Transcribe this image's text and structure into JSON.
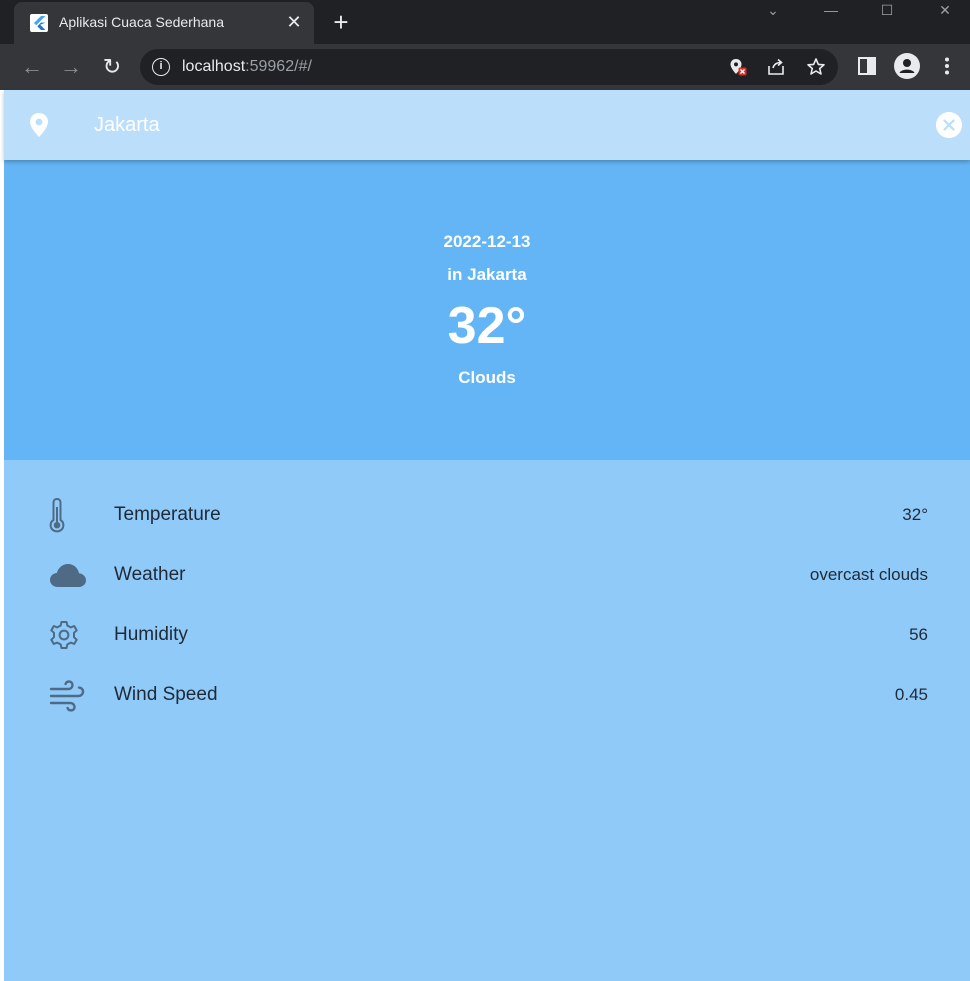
{
  "browser": {
    "tab_title": "Aplikasi Cuaca Sederhana",
    "tab_close": "✕",
    "new_tab": "+",
    "url_host": "localhost",
    "url_rest": ":59962/#/",
    "icons": [
      "flutter-favicon",
      "back-arrow-icon",
      "forward-arrow-icon",
      "reload-icon",
      "site-info-icon",
      "location-blocked-icon",
      "share-icon",
      "bookmark-star-icon",
      "side-panel-icon",
      "profile-icon",
      "menu-kebab-icon"
    ]
  },
  "search": {
    "value": "Jakarta",
    "icon": "location-pin-icon",
    "clear_icon": "clear-circle-icon"
  },
  "current": {
    "date": "2022-12-13",
    "city_line": "in Jakarta",
    "temperature": "32°",
    "description": "Clouds"
  },
  "details": [
    {
      "icon": "thermometer-icon",
      "label": "Temperature",
      "value": "32°"
    },
    {
      "icon": "cloud-icon",
      "label": "Weather",
      "value": "overcast clouds"
    },
    {
      "icon": "gear-icon",
      "label": "Humidity",
      "value": "56"
    },
    {
      "icon": "wind-icon",
      "label": "Wind Speed",
      "value": "0.45"
    }
  ],
  "colors": {
    "search_bar": "#bbdefb",
    "hero": "#64b5f6",
    "body": "#90caf9",
    "icon": "#4f6a85"
  }
}
